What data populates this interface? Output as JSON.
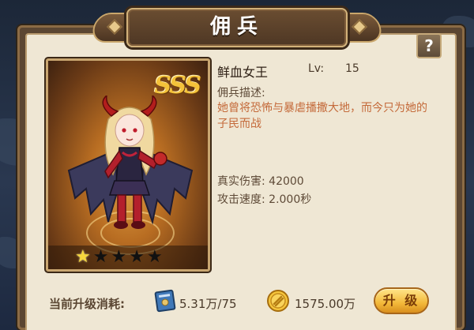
{
  "window": {
    "title": "佣兵"
  },
  "help": {
    "label": "?"
  },
  "hero": {
    "rarity": "SSS",
    "name": "鲜血女王",
    "level_label": "Lv:",
    "level": "15",
    "stars_filled": 1,
    "stars_total": 5,
    "description_label": "佣兵描述:",
    "description": "她曾将恐怖与暴虐播撒大地，而今只为她的子民而战",
    "stats": [
      {
        "label": "真实伤害:",
        "value": "42000"
      },
      {
        "label": "攻击速度:",
        "value": "2.000秒"
      }
    ]
  },
  "upgrade": {
    "cost_label": "当前升级消耗:",
    "book_cost": "5.31万/75",
    "gold_cost": "1575.00万",
    "button_label": "升 级"
  },
  "icons": [
    "help-icon",
    "book-icon",
    "gold-coin-icon",
    "star-icon"
  ],
  "colors": {
    "accent_gold": "#f3b93a",
    "panel": "#efe7d4",
    "frame": "#5b4632",
    "description": "#c46a3a"
  }
}
